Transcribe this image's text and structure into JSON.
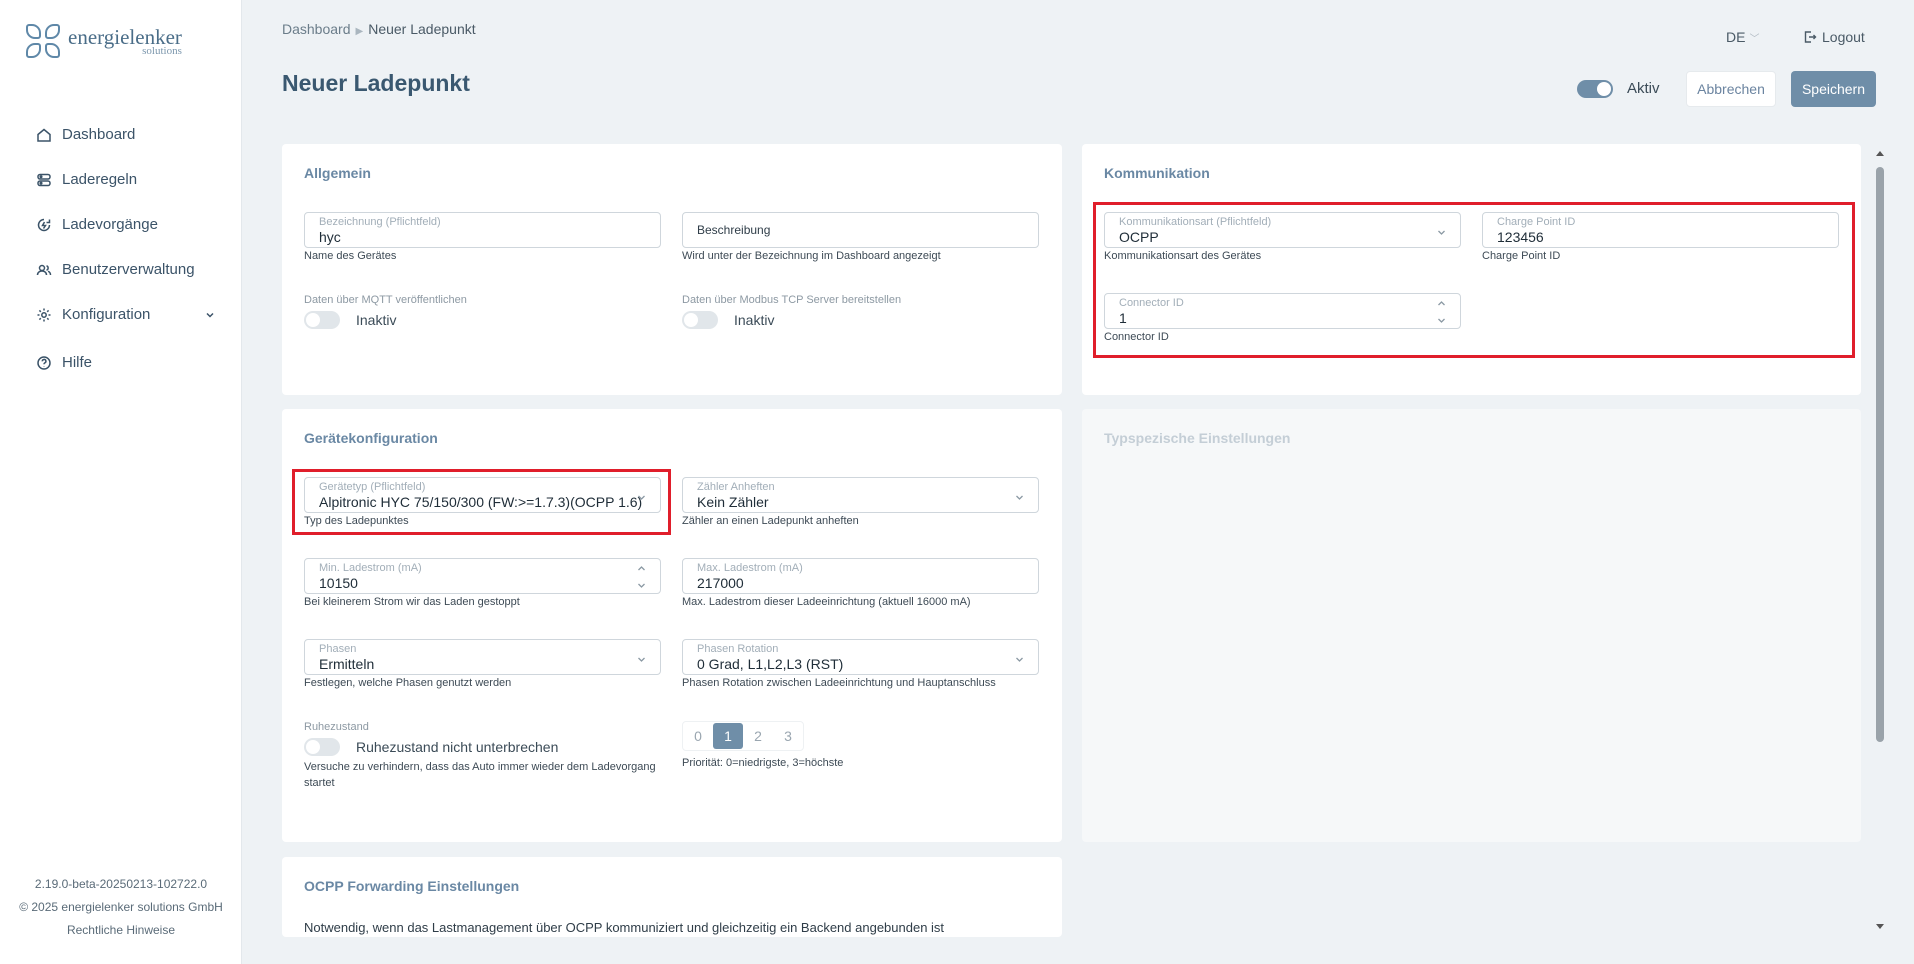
{
  "brand": {
    "name": "energielenker",
    "sub": "solutions"
  },
  "sidebar": {
    "items": [
      {
        "label": "Dashboard",
        "icon": "home-icon"
      },
      {
        "label": "Laderegeln",
        "icon": "rules-icon"
      },
      {
        "label": "Ladevorgänge",
        "icon": "charging-icon"
      },
      {
        "label": "Benutzerverwaltung",
        "icon": "users-icon"
      },
      {
        "label": "Konfiguration",
        "icon": "gear-icon"
      },
      {
        "label": "Hilfe",
        "icon": "help-icon"
      }
    ],
    "version": "2.19.0-beta-20250213-102722.0",
    "copyright": "© 2025 energielenker solutions GmbH",
    "legal": "Rechtliche Hinweise"
  },
  "header": {
    "breadcrumb_home": "Dashboard",
    "breadcrumb_current": "Neuer Ladepunkt",
    "title": "Neuer Ladepunkt",
    "language": "DE",
    "logout": "Logout",
    "active_label": "Aktiv",
    "cancel": "Abbrechen",
    "save": "Speichern"
  },
  "allgemein": {
    "title": "Allgemein",
    "name_label": "Bezeichnung (Pflichtfeld)",
    "name_value": "hyc",
    "name_hint": "Name des Gerätes",
    "desc_placeholder": "Beschreibung",
    "desc_hint": "Wird unter der Bezeichnung im Dashboard angezeigt",
    "mqtt_label": "Daten über MQTT veröffentlichen",
    "mqtt_state": "Inaktiv",
    "modbus_label": "Daten über Modbus TCP Server bereitstellen",
    "modbus_state": "Inaktiv"
  },
  "kommunikation": {
    "title": "Kommunikation",
    "type_label": "Kommunikationsart (Pflichtfeld)",
    "type_value": "OCPP",
    "type_hint": "Kommunikationsart des Gerätes",
    "cpid_label": "Charge Point ID",
    "cpid_value": "123456",
    "cpid_hint": "Charge Point ID",
    "connector_label": "Connector ID",
    "connector_value": "1",
    "connector_hint": "Connector ID"
  },
  "geraet": {
    "title": "Gerätekonfiguration",
    "type_label": "Gerätetyp (Pflichtfeld)",
    "type_value": "Alpitronic HYC 75/150/300 (FW:>=1.7.3)(OCPP 1.6)",
    "type_hint": "Typ des Ladepunktes",
    "meter_label": "Zähler Anheften",
    "meter_value": "Kein Zähler",
    "meter_hint": "Zähler an einen Ladepunkt anheften",
    "min_label": "Min. Ladestrom (mA)",
    "min_value": "10150",
    "min_hint": "Bei kleinerem Strom wir das Laden gestoppt",
    "max_label": "Max. Ladestrom (mA)",
    "max_value": "217000",
    "max_hint": "Max. Ladestrom dieser Ladeeinrichtung (aktuell 16000 mA)",
    "phases_label": "Phasen",
    "phases_value": "Ermitteln",
    "phases_hint": "Festlegen, welche Phasen genutzt werden",
    "rotation_label": "Phasen Rotation",
    "rotation_value": "0 Grad, L1,L2,L3 (RST)",
    "rotation_hint": "Phasen Rotation zwischen Ladeeinrichtung und Hauptanschluss",
    "rest_label": "Ruhezustand",
    "rest_toggle_label": "Ruhezustand nicht unterbrechen",
    "rest_hint_1": "Versuche zu verhindern, dass das Auto immer wieder dem Ladevorgang",
    "rest_hint_2": "startet",
    "priority_options": [
      "0",
      "1",
      "2",
      "3"
    ],
    "priority_selected": "1",
    "priority_hint": "Priorität: 0=niedrigste, 3=höchste"
  },
  "typspezifisch": {
    "title": "Typspezische Einstellungen"
  },
  "ocpp_forwarding": {
    "title": "OCPP Forwarding Einstellungen",
    "text": "Notwendig, wenn das Lastmanagement über OCPP kommuniziert und gleichzeitig ein Backend angebunden ist"
  },
  "colors": {
    "accent": "#6f8ea8",
    "highlight": "#e01e2b",
    "title": "#3a5870"
  }
}
